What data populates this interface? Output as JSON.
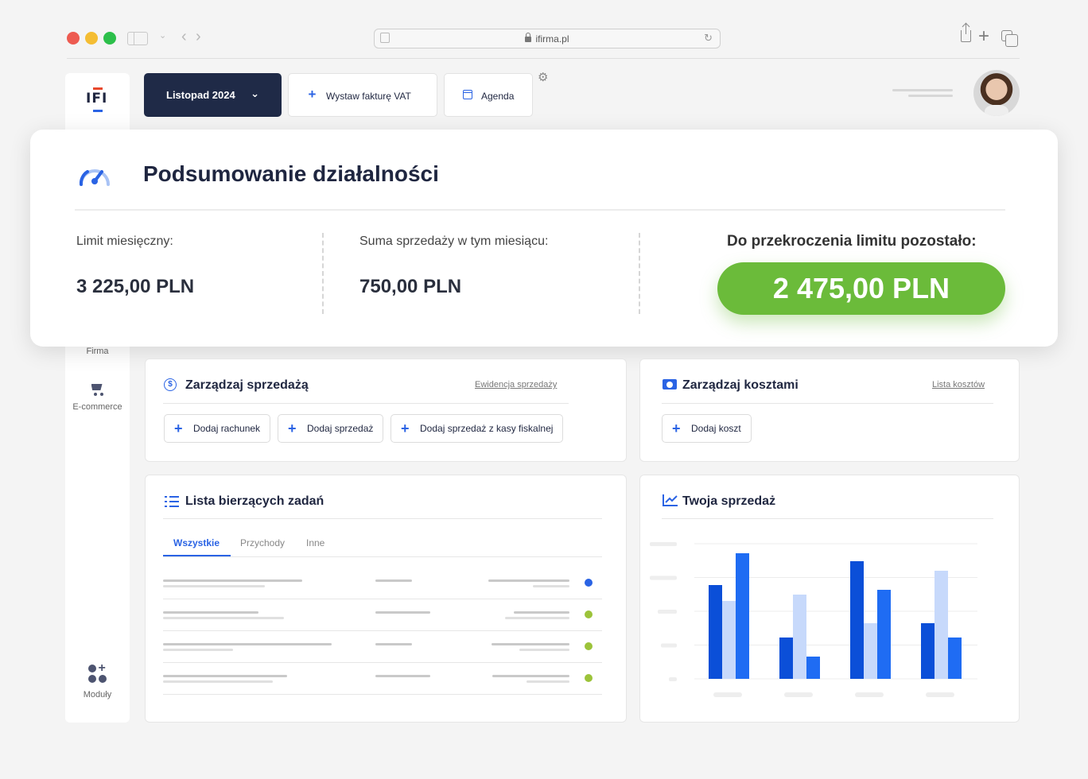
{
  "browser": {
    "url": "ifirma.pl"
  },
  "sidebar": {
    "firma_label": "Firma",
    "ecommerce_label": "E-commerce",
    "modules_label": "Moduły"
  },
  "toolbar": {
    "period_label": "Listopad 2024",
    "invoice_label": "Wystaw fakturę VAT",
    "agenda_label": "Agenda"
  },
  "summary": {
    "title": "Podsumowanie działalności",
    "monthly_limit_label": "Limit miesięczny:",
    "monthly_limit_value": "3 225,00 PLN",
    "sales_label": "Suma sprzedaży w tym miesiącu:",
    "sales_value": "750,00 PLN",
    "remaining_label": "Do przekroczenia limitu pozostało:",
    "remaining_value": "2 475,00 PLN"
  },
  "sales_card": {
    "title": "Zarządzaj sprzedażą",
    "link": "Ewidencja sprzedaży",
    "buttons": [
      "Dodaj rachunek",
      "Dodaj sprzedaż",
      "Dodaj sprzedaż z kasy fiskalnej"
    ]
  },
  "costs_card": {
    "title": "Zarządzaj kosztami",
    "link": "Lista kosztów",
    "button": "Dodaj koszt"
  },
  "tasks_card": {
    "title": "Lista bierzących zadań",
    "tabs": [
      "Wszystkie",
      "Przychody",
      "Inne"
    ],
    "active_tab": "Wszystkie",
    "rows": [
      {
        "status_color": "#2a63e4"
      },
      {
        "status_color": "#9cc33a"
      },
      {
        "status_color": "#9cc33a"
      },
      {
        "status_color": "#9cc33a"
      }
    ]
  },
  "chart_card": {
    "title": "Twoja sprzedaż"
  },
  "chart_data": {
    "type": "bar",
    "categories": [
      "",
      "",
      "",
      ""
    ],
    "series": [
      {
        "color": "#0b4fd8",
        "values": [
          118,
          52,
          148,
          70
        ]
      },
      {
        "color": "#c7d9fb",
        "values": [
          98,
          106,
          70,
          136
        ]
      },
      {
        "color": "#1f6cf3",
        "values": [
          158,
          28,
          112,
          52
        ]
      }
    ],
    "ylim": [
      0,
      170
    ],
    "grid": true
  },
  "colors": {
    "accent": "#2a63e4",
    "navy": "#1f2a47",
    "success": "#6bbb3a"
  }
}
